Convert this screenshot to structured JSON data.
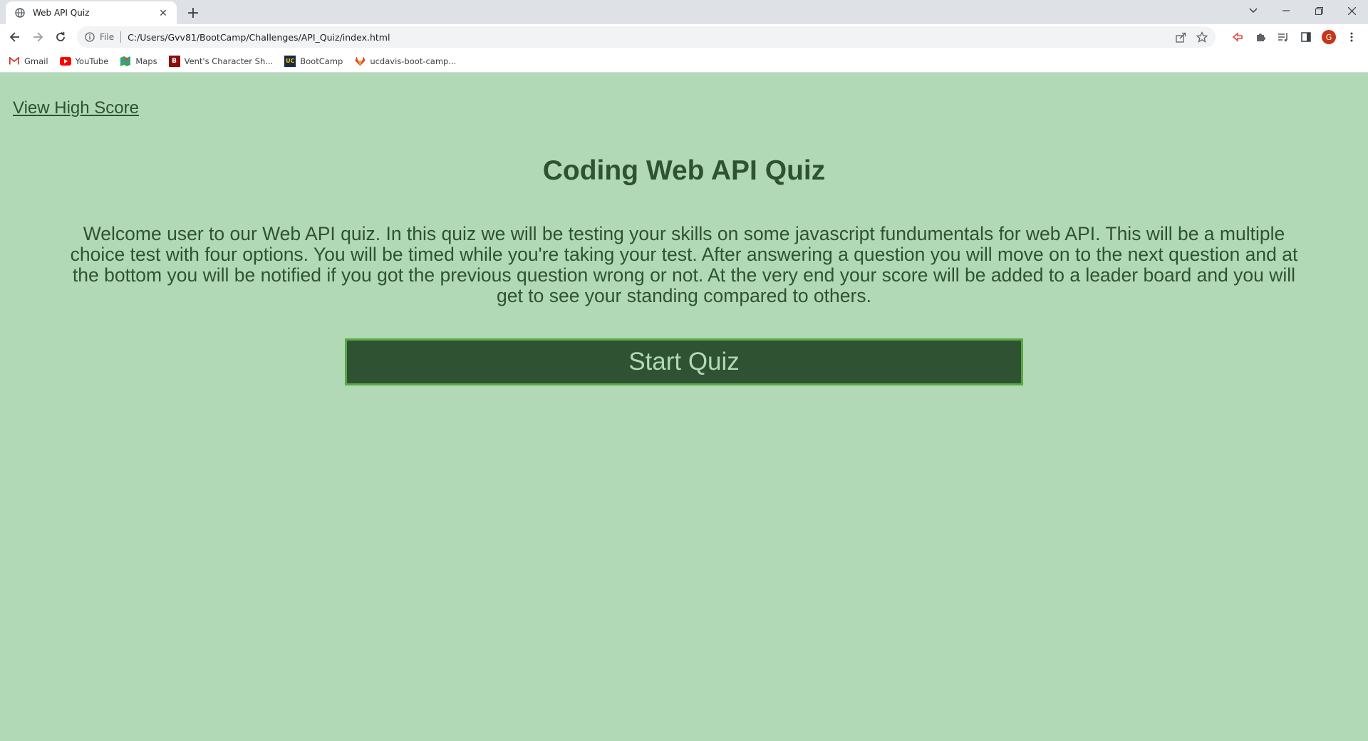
{
  "browser": {
    "tab_title": "Web API Quiz",
    "url_scheme_label": "File",
    "url": "C:/Users/Gvv81/BootCamp/Challenges/API_Quiz/index.html",
    "profile_initial": "G"
  },
  "bookmarks": [
    {
      "label": "Gmail",
      "icon": "gmail-icon"
    },
    {
      "label": "YouTube",
      "icon": "youtube-icon"
    },
    {
      "label": "Maps",
      "icon": "maps-icon"
    },
    {
      "label": "Vent's Character Sh...",
      "icon": "bookmark-b-icon"
    },
    {
      "label": "BootCamp",
      "icon": "uc-icon"
    },
    {
      "label": "ucdavis-boot-camp...",
      "icon": "gitlab-icon"
    }
  ],
  "page": {
    "high_score_link": "View High Score",
    "title": "Coding Web API Quiz",
    "intro": "Welcome user to our Web API quiz. In this quiz we will be testing your skills on some javascript fundumentals for web API. This will be a multiple choice test with four options. You will be timed while you're taking your test. After answering a question you will move on to the next question and at the bottom you will be notified if you got the previous question wrong or not. At the very end your score will be added to a leader board and you will get to see your standing compared to others.",
    "start_button": "Start Quiz"
  },
  "colors": {
    "background": "#b2d9b5",
    "text": "#2f5233",
    "button_bg": "#2f5233",
    "button_border": "#58a844",
    "button_text": "#b2d9b5"
  }
}
